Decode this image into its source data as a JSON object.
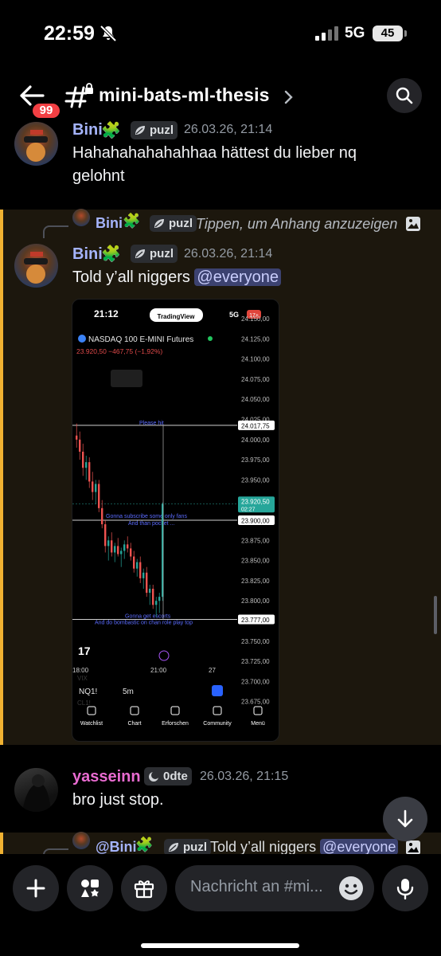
{
  "status": {
    "time": "22:59",
    "network": "5G",
    "battery": "45"
  },
  "header": {
    "unread_badge": "99",
    "channel_name": "mini-bats-ml-thesis"
  },
  "messages": [
    {
      "username": "Bini",
      "tag": "puzl",
      "timestamp": "26.03.26, 21:14",
      "text": "Hahahahahahahhaa hättest du lieber nq gelohnt"
    },
    {
      "reply": {
        "username": "Bini",
        "tag": "puzl",
        "preview": "Tippen, um Anhang anzuzeigen"
      },
      "username": "Bini",
      "tag": "puzl",
      "timestamp": "26.03.26, 21:14",
      "text": "Told y’all niggers",
      "mention": "@everyone"
    },
    {
      "username": "yasseinn",
      "tag": "0dte",
      "timestamp": "26.03.26, 21:15",
      "text": "bro just stop."
    },
    {
      "reply": {
        "username": "@Bini",
        "tag": "puzl",
        "preview": "Told y’all niggers",
        "mention": "@everyone"
      }
    }
  ],
  "screenshot": {
    "time": "21:12",
    "app_logo": "TradingView",
    "network": "5G",
    "battery": "17+",
    "symbol": "NASDAQ 100 E-MINI Futures",
    "price_line": "23.920,50  −467,75 (−1,92%)",
    "price_ticks": [
      "24.150,00",
      "24.125,00",
      "24.100,00",
      "24.075,00",
      "24.050,00",
      "24.025,00",
      "24.000,00",
      "23.975,00",
      "23.950,00",
      "23.925,00",
      "23.900,00",
      "23.875,00",
      "23.850,00",
      "23.825,00",
      "23.800,00",
      "23.775,00",
      "23.750,00",
      "23.725,00",
      "23.700,00",
      "23.675,00"
    ],
    "line_labels": {
      "top": "24.017,75",
      "current": "23.920,50",
      "countdown": "02:27",
      "mid": "23.900,00",
      "low": "23.777,00"
    },
    "annotations": {
      "please": "Please hit",
      "fans1": "Gonna subscribe some only fans",
      "fans2": "And than pocket ...",
      "escort1": "Gonna get escorts",
      "escort2": "And do bombastic on chan role play top"
    },
    "time_ticks": [
      "18:00",
      "21:00",
      "27"
    ],
    "ticker": "NQ1!",
    "interval": "5m",
    "ghost": [
      "VIX",
      "CL1!"
    ],
    "nav": [
      "Watchlist",
      "Chart",
      "Erforschen",
      "Community",
      "Menü"
    ]
  },
  "composer": {
    "placeholder": "Nachricht an #mi..."
  },
  "colors": {
    "bini": "#a5b4fc",
    "yasseinn": "#e86bd0",
    "mention_bg": "#3c4270",
    "highlight_bar": "#f0b232"
  }
}
